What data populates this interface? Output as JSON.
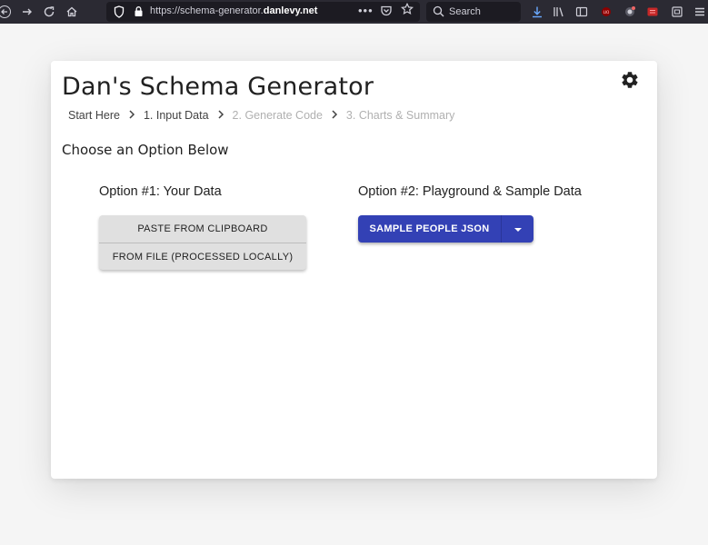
{
  "browser": {
    "url_prefix": "https://schema-generator.",
    "url_host": "danlevy.net",
    "more_label": "•••",
    "search_placeholder": "Search",
    "nav_icons": [
      "back-icon",
      "forward-icon",
      "reload-icon",
      "home-icon"
    ],
    "toolbar_icons": [
      "download-icon",
      "library-icon",
      "sidebar-icon",
      "ublock-icon",
      "extension-icon",
      "extension-red-icon",
      "screenshot-icon",
      "menu-icon"
    ]
  },
  "page": {
    "title": "Dan's Schema Generator",
    "settings_icon": "gear-icon",
    "breadcrumb": [
      {
        "label": "Start Here",
        "state": "active"
      },
      {
        "label": "1. Input Data",
        "state": "active"
      },
      {
        "label": "2. Generate Code",
        "state": "disabled"
      },
      {
        "label": "3. Charts & Summary",
        "state": "disabled"
      }
    ],
    "choose_label": "Choose an Option Below",
    "option1": {
      "heading": "Option #1: Your Data",
      "buttons": [
        "PASTE FROM CLIPBOARD",
        "FROM FILE (PROCESSED LOCALLY)"
      ]
    },
    "option2": {
      "heading": "Option #2: Playground & Sample Data",
      "button_label": "SAMPLE PEOPLE JSON",
      "dropdown_icon": "caret-down-icon"
    }
  },
  "colors": {
    "primary": "#3341b5",
    "toolbar_bg": "#2b2a33",
    "disabled_text": "#b0b0b0"
  }
}
